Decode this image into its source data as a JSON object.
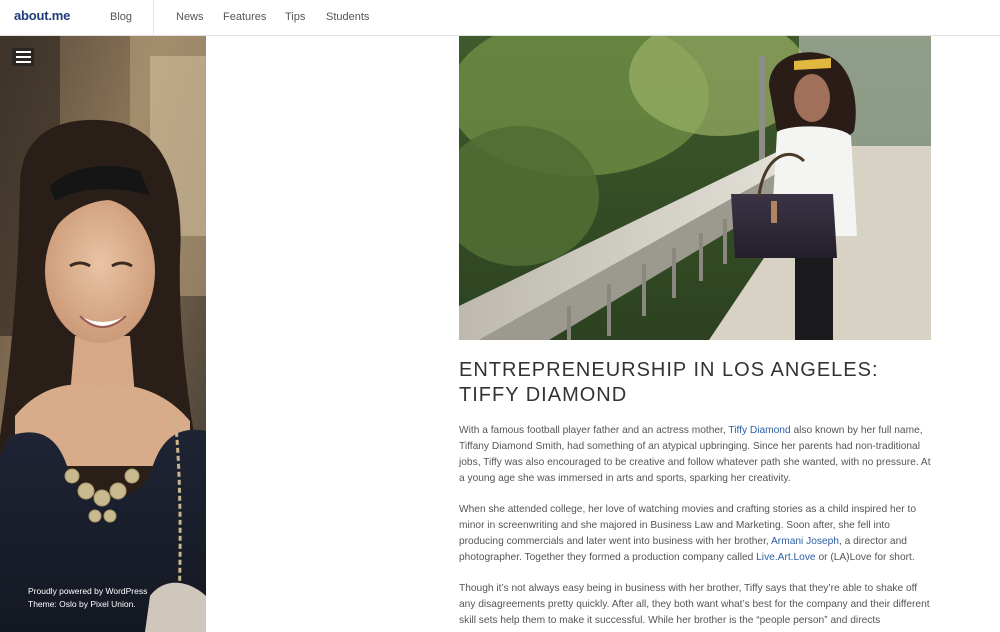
{
  "header": {
    "logo": "about.me",
    "blog_label": "Blog",
    "nav": [
      "News",
      "Features",
      "Tips",
      "Students"
    ]
  },
  "sidebar": {
    "credits_line1": "Proudly powered by WordPress",
    "credits_line2": "Theme: Oslo by Pixel Union."
  },
  "article": {
    "title_line1": "ENTREPRENEURSHIP IN LOS ANGELES:",
    "title_line2": "TIFFY DIAMOND",
    "p1": {
      "before": "With a famous football player father and an actress mother, ",
      "link": "Tiffy Diamond",
      "after": " also known by her full name, Tiffany Diamond Smith, had something of an atypical upbringing. Since her parents had non-traditional jobs, Tiffy was also encouraged to be creative and follow whatever path she wanted, with no pressure. At a young age she was immersed in arts and sports, sparking her creativity."
    },
    "p2": {
      "before": "When she attended college, her love of watching movies and crafting stories as a child inspired her to minor in screenwriting and she majored in Business Law and Marketing. Soon after, she fell into producing commercials and later went into business with her brother, ",
      "link1": "Armani Joseph",
      "middle": ", a director and photographer. Together they formed a production company called ",
      "link2": "Live.Art.Love",
      "after": " or (LA)Love for short."
    },
    "p3": "Though it’s not always easy being in business with her brother, Tiffy says that they’re able to shake off any disagreements pretty quickly. After all, they both want what’s best for the company and their different skill sets help them to make it successful. While her brother is the “people person” and directs"
  },
  "colors": {
    "logo": "#1f3d7a",
    "link": "#2d5fa5",
    "title": "#333333",
    "body_text": "#555555"
  },
  "icons": {
    "menu": "hamburger-menu-icon"
  }
}
